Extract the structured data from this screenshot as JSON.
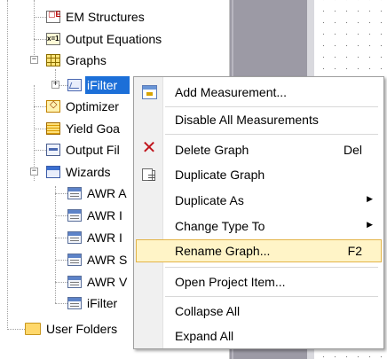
{
  "tree": {
    "items": [
      {
        "id": "em",
        "label": "EM Structures",
        "icon": "em-structures-icon"
      },
      {
        "id": "eq",
        "label": "Output Equations",
        "icon": "output-equations-icon"
      },
      {
        "id": "graphs",
        "label": "Graphs",
        "icon": "graphs-icon",
        "expander": "−"
      },
      {
        "id": "ifilter",
        "label": "iFilter",
        "icon": "graph-icon",
        "expander": "+"
      },
      {
        "id": "opt",
        "label": "Optimizer",
        "icon": "optimizer-icon"
      },
      {
        "id": "yield",
        "label": "Yield Goa",
        "icon": "yield-goals-icon"
      },
      {
        "id": "outfiles",
        "label": "Output Fil",
        "icon": "output-files-icon"
      },
      {
        "id": "wizards",
        "label": "Wizards",
        "icon": "wizards-icon",
        "expander": "−"
      },
      {
        "id": "awr1",
        "label": "AWR A",
        "icon": "wizard-item-icon"
      },
      {
        "id": "awr2",
        "label": "AWR I",
        "icon": "wizard-item-icon"
      },
      {
        "id": "awr3",
        "label": "AWR I",
        "icon": "wizard-item-icon"
      },
      {
        "id": "awr4",
        "label": "AWR S",
        "icon": "wizard-item-icon"
      },
      {
        "id": "awr5",
        "label": "AWR V",
        "icon": "wizard-item-icon"
      },
      {
        "id": "ifilter2",
        "label": "iFilter",
        "icon": "wizard-item-icon"
      },
      {
        "id": "userfolders",
        "label": "User Folders",
        "icon": "folder-icon"
      }
    ]
  },
  "context_menu": {
    "items": [
      {
        "label": "Add Measurement...",
        "icon": "add-measurement-icon"
      },
      {
        "label": "Disable All Measurements"
      },
      {
        "label": "Delete Graph",
        "shortcut": "Del",
        "icon": "delete-icon"
      },
      {
        "label": "Duplicate Graph",
        "icon": "duplicate-icon"
      },
      {
        "label": "Duplicate As",
        "submenu": "▶"
      },
      {
        "label": "Change Type To",
        "submenu": "▶"
      },
      {
        "label": "Rename Graph...",
        "shortcut": "F2"
      },
      {
        "label": "Open Project Item..."
      },
      {
        "label": "Collapse All"
      },
      {
        "label": "Expand All"
      }
    ]
  },
  "colors": {
    "selection": "#1c6fd8",
    "menu_highlight": "#fff4c7",
    "menu_highlight_border": "#e3b449",
    "panel_gray": "#9c9aa5"
  }
}
